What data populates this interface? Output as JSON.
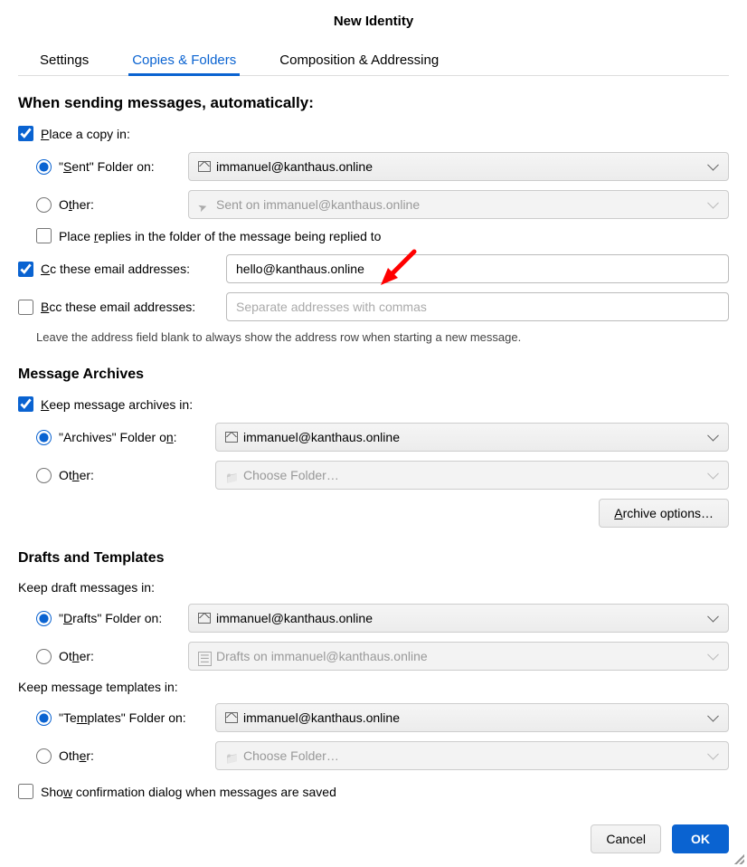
{
  "title": "New Identity",
  "tabs": {
    "settings": "Settings",
    "copies": "Copies & Folders",
    "composition": "Composition & Addressing"
  },
  "section1": {
    "heading": "When sending messages, automatically:",
    "place_copy": "Place a copy in:",
    "sent_folder_on": "\"Sent\" Folder on:",
    "sent_account": "immanuel@kanthaus.online",
    "other": "Other:",
    "other_sent": "Sent on immanuel@kanthaus.online",
    "place_replies": "Place replies in the folder of the message being replied to"
  },
  "cc": {
    "label": "Cc these email addresses:",
    "value": "hello@kanthaus.online"
  },
  "bcc": {
    "label": "Bcc these email addresses:",
    "placeholder": "Separate addresses with commas"
  },
  "hint": "Leave the address field blank to always show the address row when starting a new message.",
  "archives": {
    "heading": "Message Archives",
    "keep": "Keep message archives in:",
    "folder_on": "\"Archives\" Folder on:",
    "account": "immanuel@kanthaus.online",
    "other": "Other:",
    "choose": "Choose Folder…",
    "options": "Archive options…"
  },
  "drafts": {
    "heading": "Drafts and Templates",
    "keep_drafts": "Keep draft messages in:",
    "drafts_folder_on": "\"Drafts\" Folder on:",
    "drafts_account": "immanuel@kanthaus.online",
    "other": "Other:",
    "drafts_other": "Drafts on immanuel@kanthaus.online",
    "keep_templates": "Keep message templates in:",
    "templates_folder_on": "\"Templates\" Folder on:",
    "templates_account": "immanuel@kanthaus.online",
    "choose": "Choose Folder…"
  },
  "confirm": "Show confirmation dialog when messages are saved",
  "buttons": {
    "cancel": "Cancel",
    "ok": "OK"
  }
}
